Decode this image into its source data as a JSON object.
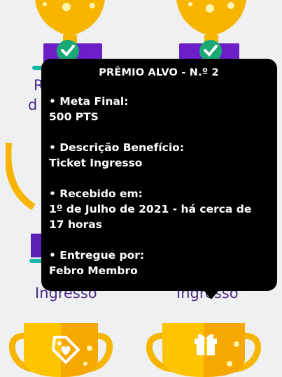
{
  "tooltip": {
    "title": "PRÊMIO ALVO - N.º 2",
    "fields": [
      {
        "label": "• Meta Final:",
        "value": "500 PTS"
      },
      {
        "label": "• Descrição Benefício:",
        "value": "Ticket Ingresso"
      },
      {
        "label": "• Recebido em:",
        "value": "1º de Julho de 2021 - há cerca de 17 horas"
      },
      {
        "label": "• Entregue por:",
        "value": "Febro Membro"
      }
    ]
  },
  "cards": {
    "top_left_label_line1": "R",
    "top_left_label_line2": "d",
    "mid_left_label": "Ingresso",
    "mid_right_label": "Ingresso"
  },
  "colors": {
    "gold": "#f7b500",
    "gold_light": "#ffd000",
    "purple": "#5b21b6",
    "teal": "#16b8a6",
    "check_green": "#19a974",
    "label_purple": "#4b2a86"
  },
  "icons": [
    "check-icon",
    "tag-heart-icon",
    "gift-icon"
  ]
}
